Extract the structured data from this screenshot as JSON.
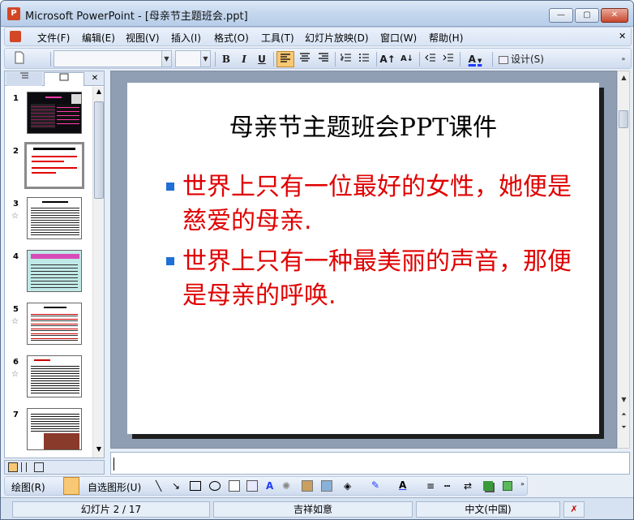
{
  "window": {
    "title": "Microsoft PowerPoint - [母亲节主题班会.ppt]",
    "app_icon": "P"
  },
  "titlebar_buttons": {
    "min": "—",
    "max": "▢",
    "close": "✕"
  },
  "menu": {
    "items": [
      "文件(F)",
      "编辑(E)",
      "视图(V)",
      "插入(I)",
      "格式(O)",
      "工具(T)",
      "幻灯片放映(D)",
      "窗口(W)",
      "帮助(H)"
    ],
    "close_mark": "✕"
  },
  "toolbar": {
    "bold": "B",
    "italic": "I",
    "underline": "U",
    "font_color_label": "A",
    "grow_font": "A↑",
    "shrink_font": "A↓",
    "design_label": "设计(S)",
    "font_name": "",
    "font_size": ""
  },
  "pane_tabs": {
    "outline_icon": "outline-icon",
    "slides_icon": "slides-icon",
    "close": "✕"
  },
  "slides_list": [
    {
      "num": "1",
      "star": ""
    },
    {
      "num": "2",
      "star": ""
    },
    {
      "num": "3",
      "star": "☆"
    },
    {
      "num": "4",
      "star": ""
    },
    {
      "num": "5",
      "star": "☆"
    },
    {
      "num": "6",
      "star": "☆"
    },
    {
      "num": "7",
      "star": ""
    }
  ],
  "selected_slide": 2,
  "slide": {
    "title": "母亲节主题班会PPT课件",
    "bullets": [
      "世界上只有一位最好的女性，她便是慈爱的母亲.",
      "世界上只有一种最美丽的声音，那便是母亲的呼唤."
    ]
  },
  "drawbar": {
    "draw_label": "绘图(R)",
    "autoshapes_label": "自选图形(U)"
  },
  "status": {
    "slide_pos": "幻灯片 2 / 17",
    "design": "吉祥如意",
    "language": "中文(中国)"
  },
  "colors": {
    "slide_title": "#000000",
    "bullet_text": "#e00000",
    "bullet_mark": "#1e6fd8",
    "thumb_dark": "#0b0b10",
    "thumb_pink": "#ff3aa8"
  }
}
